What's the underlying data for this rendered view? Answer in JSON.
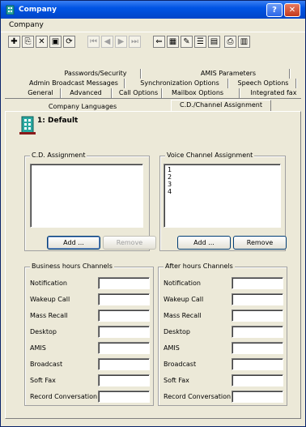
{
  "window": {
    "title": "Company",
    "help_label": "?",
    "close_label": "✕"
  },
  "menu": {
    "company_label": "Company"
  },
  "toolbar": [
    {
      "name": "add-icon",
      "glyph": "✚"
    },
    {
      "name": "copy-icon",
      "glyph": "⎘"
    },
    {
      "name": "delete-icon",
      "glyph": "✕"
    },
    {
      "name": "save-icon",
      "glyph": "▣"
    },
    {
      "name": "refresh-icon",
      "glyph": "⟳"
    },
    {
      "name": "first-record-icon",
      "glyph": "⏮"
    },
    {
      "name": "prev-record-icon",
      "glyph": "◀"
    },
    {
      "name": "next-record-icon",
      "glyph": "▶"
    },
    {
      "name": "last-record-icon",
      "glyph": "⏭"
    },
    {
      "name": "find-icon",
      "glyph": "⇐"
    },
    {
      "name": "filter-icon",
      "glyph": "▦"
    },
    {
      "name": "edit-icon",
      "glyph": "✎"
    },
    {
      "name": "properties-icon",
      "glyph": "☰"
    },
    {
      "name": "report-icon",
      "glyph": "▤"
    },
    {
      "name": "print-icon",
      "glyph": "⎙"
    },
    {
      "name": "exit-icon",
      "glyph": "▥"
    }
  ],
  "tabs": {
    "row1": [
      "Passwords/Security",
      "AMIS Parameters"
    ],
    "row2": [
      "Admin Broadcast Messages",
      "Synchronization Options",
      "Speech Options"
    ],
    "row3": [
      "General",
      "Advanced",
      "Call Options",
      "Mailbox Options",
      "Integrated fax"
    ],
    "row4": [
      "Company Languages",
      "C.D./Channel Assignment"
    ]
  },
  "entry": {
    "label": "1: Default"
  },
  "cd_assignment": {
    "title": "C.D. Assignment",
    "add_label": "Add ...",
    "remove_label": "Remove"
  },
  "voice_channel": {
    "title": "Voice Channel Assignment",
    "items": [
      "1",
      "2",
      "3",
      "4"
    ],
    "add_label": "Add ...",
    "remove_label": "Remove"
  },
  "business_hours": {
    "title": "Business hours Channels",
    "rows": [
      "Notification",
      "Wakeup Call",
      "Mass Recall",
      "Desktop",
      "AMIS",
      "Broadcast",
      "Soft Fax",
      "Record Conversation"
    ]
  },
  "after_hours": {
    "title": "After hours Channels",
    "rows": [
      "Notification",
      "Wakeup Call",
      "Mass Recall",
      "Desktop",
      "AMIS",
      "Broadcast",
      "Soft Fax",
      "Record Conversation"
    ]
  }
}
